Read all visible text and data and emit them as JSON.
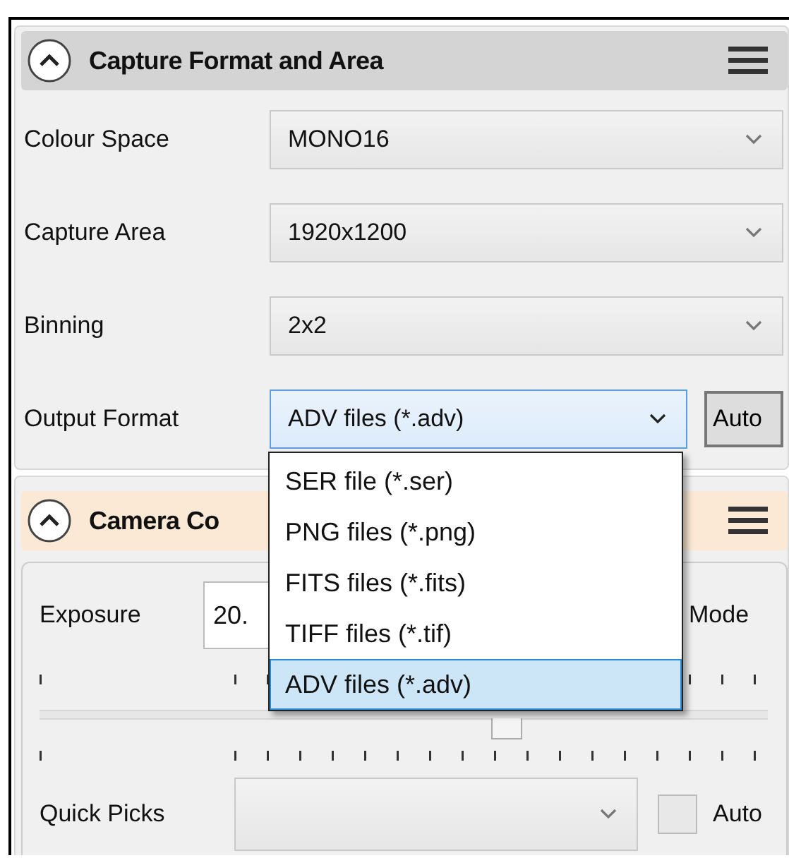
{
  "capture_panel": {
    "title": "Capture Format and Area",
    "expanded": true,
    "fields": [
      {
        "label": "Colour Space",
        "value": "MONO16",
        "focused": false
      },
      {
        "label": "Capture Area",
        "value": "1920x1200",
        "focused": false
      },
      {
        "label": "Binning",
        "value": "2x2",
        "focused": false
      },
      {
        "label": "Output Format",
        "value": "ADV files (*.adv)",
        "focused": true
      }
    ],
    "auto_button": "Auto",
    "dropdown_options": [
      {
        "label": "SER file (*.ser)",
        "selected": false
      },
      {
        "label": "PNG files (*.png)",
        "selected": false
      },
      {
        "label": "FITS files (*.fits)",
        "selected": false
      },
      {
        "label": "TIFF files (*.tif)",
        "selected": false
      },
      {
        "label": "ADV files (*.adv)",
        "selected": true
      }
    ]
  },
  "camera_panel": {
    "title": "Camera Co",
    "expanded": true,
    "exposure_label": "Exposure",
    "exposure_value": "20.",
    "mode_label": "Mode",
    "slider": {
      "level": 0.64
    },
    "quick_picks_label": "Quick Picks",
    "auto_checkbox": {
      "label": "Auto",
      "checked": false
    }
  }
}
